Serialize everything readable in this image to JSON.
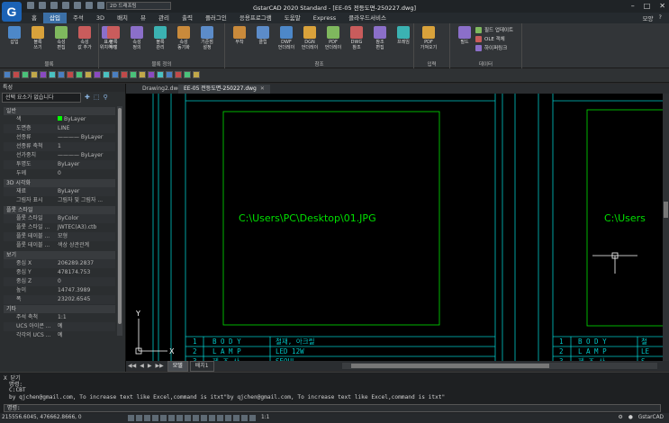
{
  "window": {
    "title": "GstarCAD 2020 Standard - [EE-05 전등도면-250227.dwg]",
    "qat_dropdown": "2D 드래프팅",
    "logo": "G"
  },
  "menu": {
    "items": [
      "홈",
      "삽입",
      "주석",
      "3D",
      "배치",
      "뷰",
      "관리",
      "출력",
      "플러그인",
      "응용프로그램",
      "도움말",
      "Express",
      "클라우드서비스"
    ],
    "active_index": 1,
    "right_label": "모양"
  },
  "ribbon": {
    "groups": [
      {
        "title": "블록",
        "buttons": [
          "삽입",
          "블록\n쓰기",
          "속성\n편집",
          "속성\n값 추가",
          "표시\n위치하기"
        ]
      },
      {
        "title": "블록 정의",
        "buttons": [
          "블록\n작성",
          "속성\n정의",
          "블록\n관리",
          "속성\n동기화",
          "기준점\n설정"
        ]
      },
      {
        "title": "참조",
        "buttons": [
          "부착",
          "클립",
          "DWF\n언더레이",
          "DGN\n언더레이",
          "PDF\n언더레이",
          "DWG\n참조",
          "참조\n편집",
          "프레임"
        ]
      },
      {
        "title": "입력",
        "buttons": [
          "PDF\n가져오기"
        ]
      },
      {
        "title": "데이터",
        "buttons": [
          "필드"
        ],
        "small": [
          "필드 업데이트",
          "OLE 객체",
          "하이퍼링크"
        ]
      }
    ]
  },
  "properties": {
    "select_placeholder": "선택 요소가 없습니다",
    "panel_label": "특성",
    "sections": [
      {
        "name": "일반",
        "rows": [
          {
            "k": "색",
            "v": "ByLayer"
          },
          {
            "k": "도면층",
            "v": "LINE"
          },
          {
            "k": "선종류",
            "v": "———— ByLayer"
          },
          {
            "k": "선종류 축척",
            "v": "1"
          },
          {
            "k": "선가중치",
            "v": "———— ByLayer"
          },
          {
            "k": "투명도",
            "v": "ByLayer"
          },
          {
            "k": "두께",
            "v": "0"
          }
        ]
      },
      {
        "name": "3D 시각화",
        "rows": [
          {
            "k": "재료",
            "v": "ByLayer"
          },
          {
            "k": "그림자 표시",
            "v": "그림자 및 그림자 ..."
          }
        ]
      },
      {
        "name": "플롯 스타일",
        "rows": [
          {
            "k": "플롯 스타일",
            "v": "ByColor"
          },
          {
            "k": "플롯 스타일 ...",
            "v": "JWTEC(A3).ctb"
          },
          {
            "k": "플롯 테이블 ...",
            "v": "모형"
          },
          {
            "k": "플롯 테이블 ...",
            "v": "색상 상관관계"
          }
        ]
      },
      {
        "name": "보기",
        "rows": [
          {
            "k": "중심 X",
            "v": "206289.2837"
          },
          {
            "k": "중심 Y",
            "v": "478174.753"
          },
          {
            "k": "중심 Z",
            "v": "0"
          },
          {
            "k": "높이",
            "v": "14747.3989"
          },
          {
            "k": "폭",
            "v": "23202.6545"
          }
        ]
      },
      {
        "name": "기타",
        "rows": [
          {
            "k": "주석 축척",
            "v": "1:1"
          },
          {
            "k": "UCS 아이콘 ...",
            "v": "예"
          },
          {
            "k": "각각의 UCS ...",
            "v": "예"
          }
        ]
      }
    ]
  },
  "doc_tabs": [
    "Drawing2.dwg",
    "EE-05 전등도면-250227.dwg"
  ],
  "doc_tab_active": 1,
  "drawing": {
    "path_text": "C:\\Users\\PC\\Desktop\\01.JPG",
    "path_text_partial": "C:\\Users",
    "table_rows": [
      {
        "no": "1",
        "name": "B O D Y",
        "desc": "철재, 아크릴"
      },
      {
        "no": "2",
        "name": "L A M P",
        "desc": "LED 12W"
      },
      {
        "no": "3",
        "name": "제 조 사",
        "desc": "SEOUL"
      }
    ],
    "table_rows_right": [
      {
        "no": "1",
        "name": "B O D Y",
        "desc": "철"
      },
      {
        "no": "2",
        "name": "L A M P",
        "desc": "LE"
      },
      {
        "no": "3",
        "name": "제 조 사",
        "desc": "S"
      }
    ],
    "ucs_x": "X",
    "ucs_y": "Y"
  },
  "model_tabs": [
    "모델",
    "배치1"
  ],
  "model_tab_active": 0,
  "command": {
    "title": "X 닫기",
    "lines": [
      "명령:",
      "C:CBT",
      "by qjchen@gmail.com, To increase text like Excel,command is itxt\"by qjchen@gmail.com, To increase text like Excel,command is itxt\""
    ],
    "prompt": "명령:"
  },
  "status": {
    "coords": "215556.6045, 476662.8666, 0",
    "scale": "1:1",
    "app": "GstarCAD"
  },
  "colors": {
    "accent": "#3b6fa6",
    "drawing_green": "#00e000",
    "drawing_cyan": "#00c8c8",
    "bylayer_swatch": "#00ff00"
  }
}
